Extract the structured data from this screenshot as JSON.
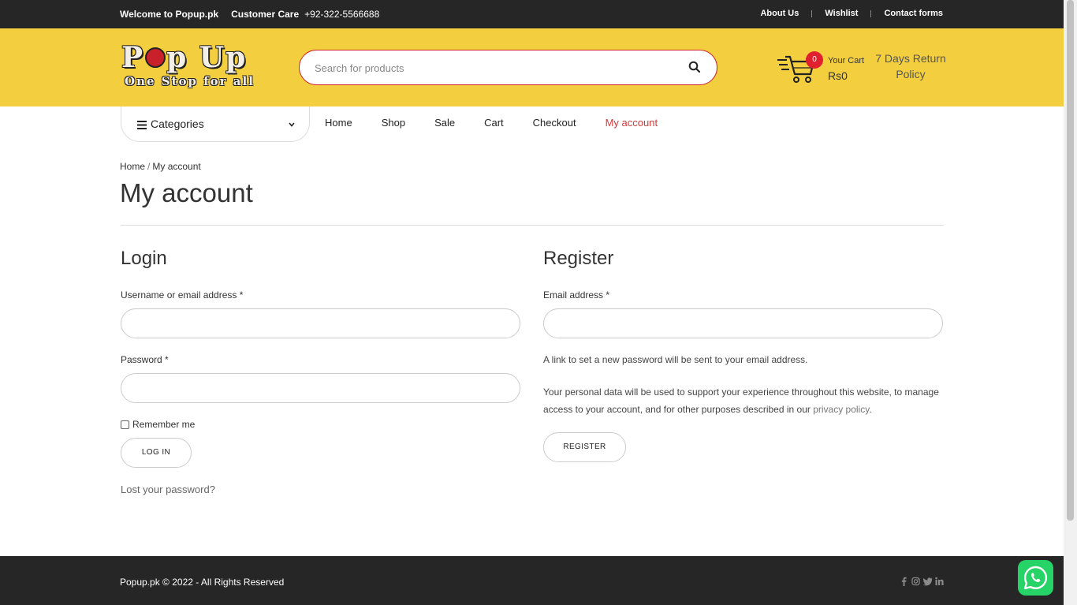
{
  "topbar": {
    "welcome": "Welcome to Popup.pk",
    "customer_care": "Customer Care",
    "phone": "+92-322-5566688",
    "links": [
      "About Us",
      "Wishlist",
      "Contact forms"
    ]
  },
  "header": {
    "logo_line1": "Pop Up",
    "logo_line2": "One Stop for all",
    "search_placeholder": "Search for products",
    "cart_count": "0",
    "cart_label": "Your Cart",
    "cart_amount": "Rs0",
    "returns": "7 Days Return Policy"
  },
  "nav": {
    "categories": "Categories",
    "items": [
      "Home",
      "Shop",
      "Sale",
      "Cart",
      "Checkout",
      "My account"
    ],
    "active": "My account"
  },
  "breadcrumb": {
    "home": "Home",
    "sep": "/",
    "current": "My account"
  },
  "page_title": "My account",
  "login": {
    "title": "Login",
    "username_label": "Username or email address",
    "password_label": "Password",
    "required": "*",
    "remember": "Remember me",
    "button": "LOG IN",
    "lost": "Lost your password?"
  },
  "register": {
    "title": "Register",
    "email_label": "Email address",
    "required": "*",
    "note": "A link to set a new password will be sent to your email address.",
    "privacy_text": "Your personal data will be used to support your experience throughout this website, to manage access to your account, and for other purposes described in our",
    "privacy_link": "privacy policy",
    "privacy_end": ".",
    "button": "REGISTER"
  },
  "footer": {
    "copyright": "Popup.pk © 2022 - All Rights Reserved",
    "social_icons": [
      "facebook-icon",
      "instagram-icon",
      "twitter-icon",
      "linkedin-icon"
    ]
  },
  "colors": {
    "topbar": "#262626",
    "header": "#f3cf3f",
    "accent": "#d13a3a",
    "whatsapp": "#25d366"
  }
}
